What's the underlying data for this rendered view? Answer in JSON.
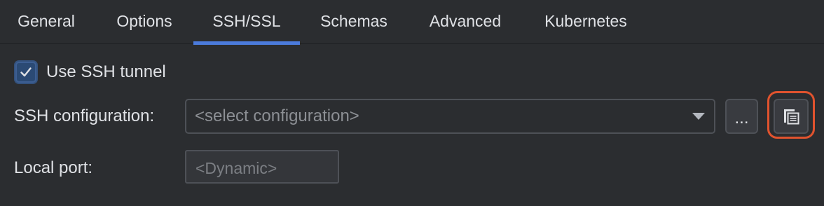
{
  "tabs": [
    {
      "label": "General",
      "active": false
    },
    {
      "label": "Options",
      "active": false
    },
    {
      "label": "SSH/SSL",
      "active": true
    },
    {
      "label": "Schemas",
      "active": false
    },
    {
      "label": "Advanced",
      "active": false
    },
    {
      "label": "Kubernetes",
      "active": false
    }
  ],
  "ssh": {
    "use_tunnel_label": "Use SSH tunnel",
    "use_tunnel_checked": true,
    "configuration_label": "SSH configuration:",
    "configuration_placeholder": "<select configuration>",
    "browse_button_label": "...",
    "copy_button_icon": "copy-icon",
    "local_port_label": "Local port:",
    "local_port_placeholder": "<Dynamic>"
  },
  "colors": {
    "background": "#2b2d30",
    "active_tab_underline": "#4b7bdc",
    "checkbox_fill": "#2b4a74",
    "highlight_outline": "#e0532e",
    "placeholder_text": "#8c8f94"
  }
}
